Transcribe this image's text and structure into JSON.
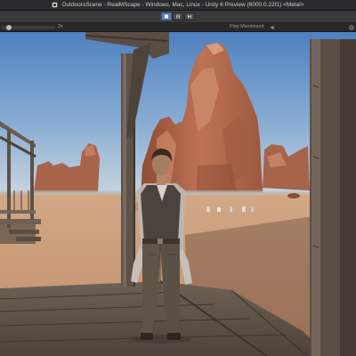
{
  "window": {
    "title": "OutdoorsScene - RealMScape - Windows, Mac, Linux - Unity 6 Preview (6000.0.22f1) <Metal>"
  },
  "toolbar": {
    "play_label": "Play",
    "pause_label": "Pause",
    "step_label": "Step"
  },
  "game_view": {
    "scale_label": "2x",
    "scale_value": 0.1,
    "maximize_label": "Play Maximized",
    "icons": [
      "unity-icon",
      "play-icon",
      "pause-icon",
      "step-icon",
      "speaker-icon",
      "gizmos-icon"
    ]
  },
  "scene": {
    "colors": {
      "sky_top": "#5b8bc6",
      "sky_bottom": "#c7d4de",
      "sand": "#c99a76",
      "rock": "#b26549",
      "wood": "#6a5a4e"
    }
  }
}
